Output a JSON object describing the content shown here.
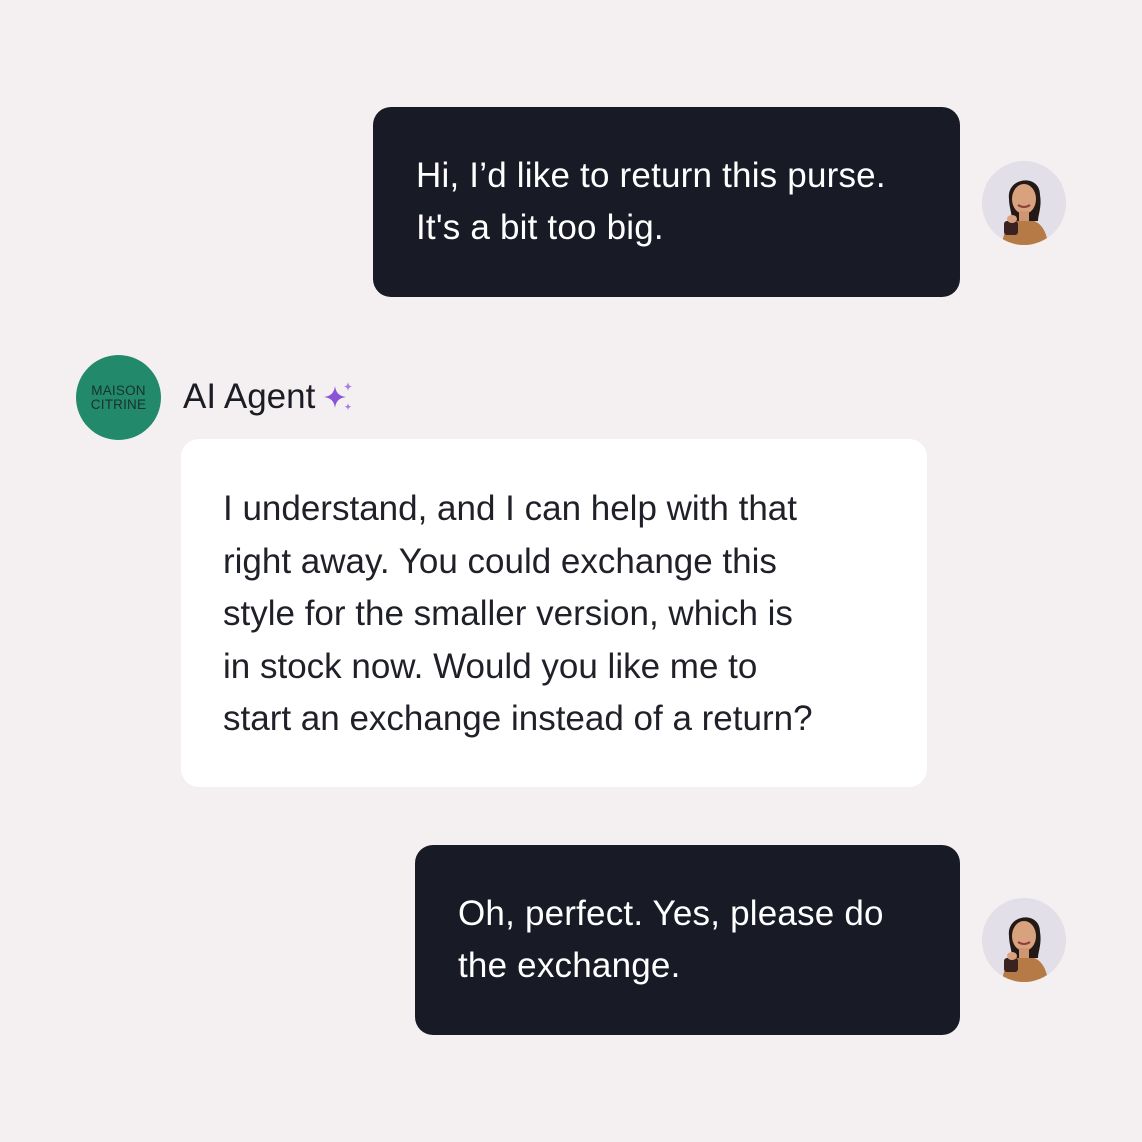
{
  "conversation": {
    "messages": [
      {
        "role": "user",
        "lines": [
          "Hi, I’d like to return this purse.",
          "It's a bit too big."
        ]
      },
      {
        "role": "agent",
        "lines": [
          "I understand, and I can help with that",
          "right away. You could exchange this",
          "style for the smaller version, which is",
          "in stock now. Would you like me to",
          "start an exchange instead of a return?"
        ]
      },
      {
        "role": "user",
        "lines": [
          "Oh, perfect. Yes, please do",
          "the exchange."
        ]
      }
    ]
  },
  "agent": {
    "name": "AI Agent",
    "logo_lines": [
      "MAISON",
      "CITRINE"
    ],
    "logo_color": "#23896b",
    "badge_icon": "sparkle-icon",
    "badge_color": "#8a54d6"
  },
  "colors": {
    "background": "#f4f0f1",
    "user_bubble": "#181b26",
    "agent_bubble": "#ffffff"
  }
}
